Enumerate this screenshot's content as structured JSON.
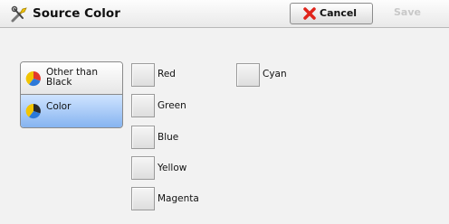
{
  "window": {
    "title": "Source Color"
  },
  "toolbar": {
    "cancel_label": "Cancel",
    "save_label": "Save"
  },
  "mode": {
    "options": [
      {
        "label_line1": "Other than",
        "label_line2": "Black",
        "selected": false
      },
      {
        "label_line1": "Color",
        "label_line2": "",
        "selected": true
      }
    ]
  },
  "colors": {
    "red": "Red",
    "green": "Green",
    "blue": "Blue",
    "yellow": "Yellow",
    "magenta": "Magenta",
    "cyan": "Cyan"
  },
  "theme": {
    "selected": "#86b4f0",
    "cancel_x": "#e0241b"
  }
}
